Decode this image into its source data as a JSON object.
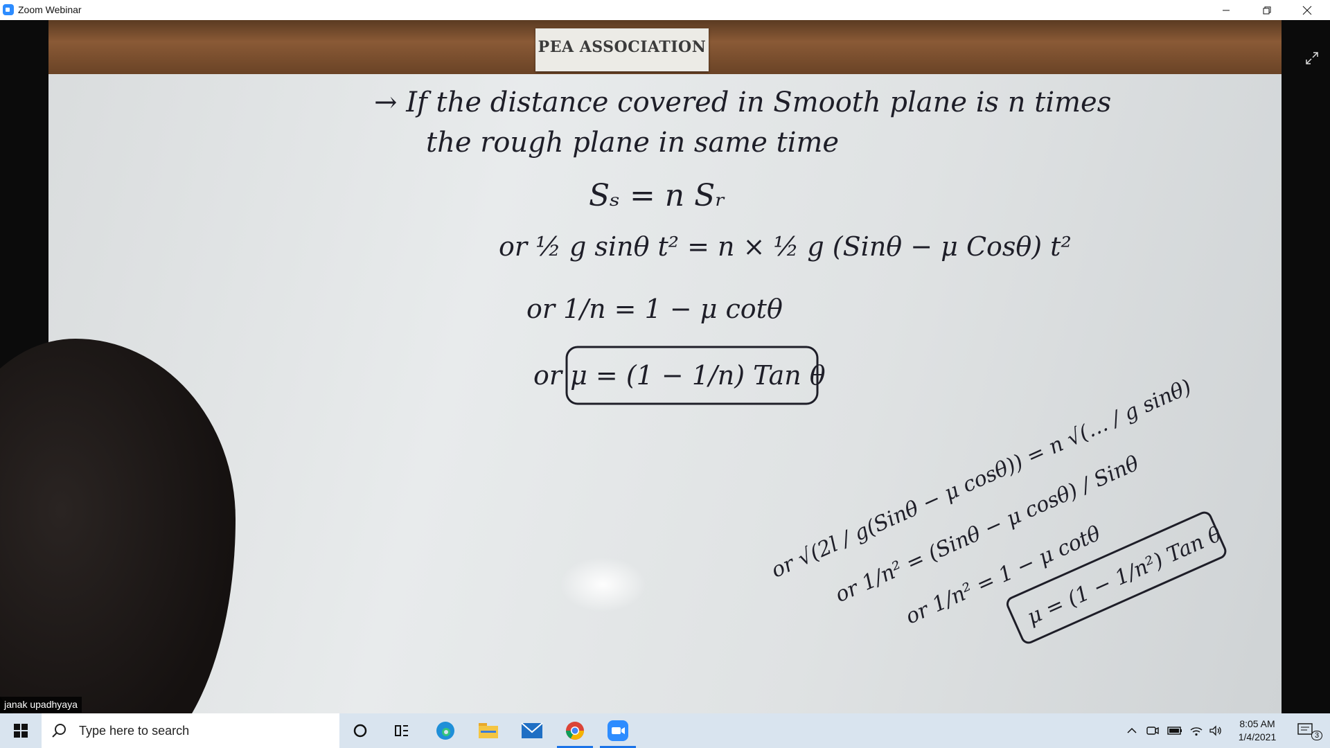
{
  "window": {
    "title": "Zoom Webinar",
    "icon": "zoom-icon"
  },
  "board": {
    "banner": "PEA ASSOCIATION",
    "lines": [
      "→ If the distance covered in Smooth plane is n times",
      "the rough plane in same time",
      "Sₛ = n Sᵣ",
      "or ½ g sinθ t² = n × ½ g (Sinθ − μ Cosθ) t²",
      "or 1/n = 1 − μ cotθ",
      "or μ = (1 − 1/n) Tan θ"
    ],
    "side_lines": [
      "or √(2l / g(Sinθ − μ cosθ)) = n √(… / g sinθ)",
      "or 1/n² = (Sinθ − μ cosθ) / Sinθ",
      "or 1/n² = 1 − μ cotθ",
      "μ = (1 − 1/n²) Tan θ"
    ]
  },
  "participant": {
    "name": "janak upadhyaya"
  },
  "taskbar": {
    "search_placeholder": "Type here to search",
    "icons": [
      "windows-start-icon",
      "cortana-icon",
      "task-view-icon",
      "edge-icon",
      "file-explorer-icon",
      "mail-icon",
      "chrome-icon",
      "zoom-icon"
    ],
    "time": "8:05 AM",
    "date": "1/4/2021",
    "notifications": "3"
  },
  "colors": {
    "taskbar": "#d9e4ef",
    "zoom_blue": "#2d8cff",
    "ink": "#1e1e28",
    "rail": "#8a5a36"
  }
}
